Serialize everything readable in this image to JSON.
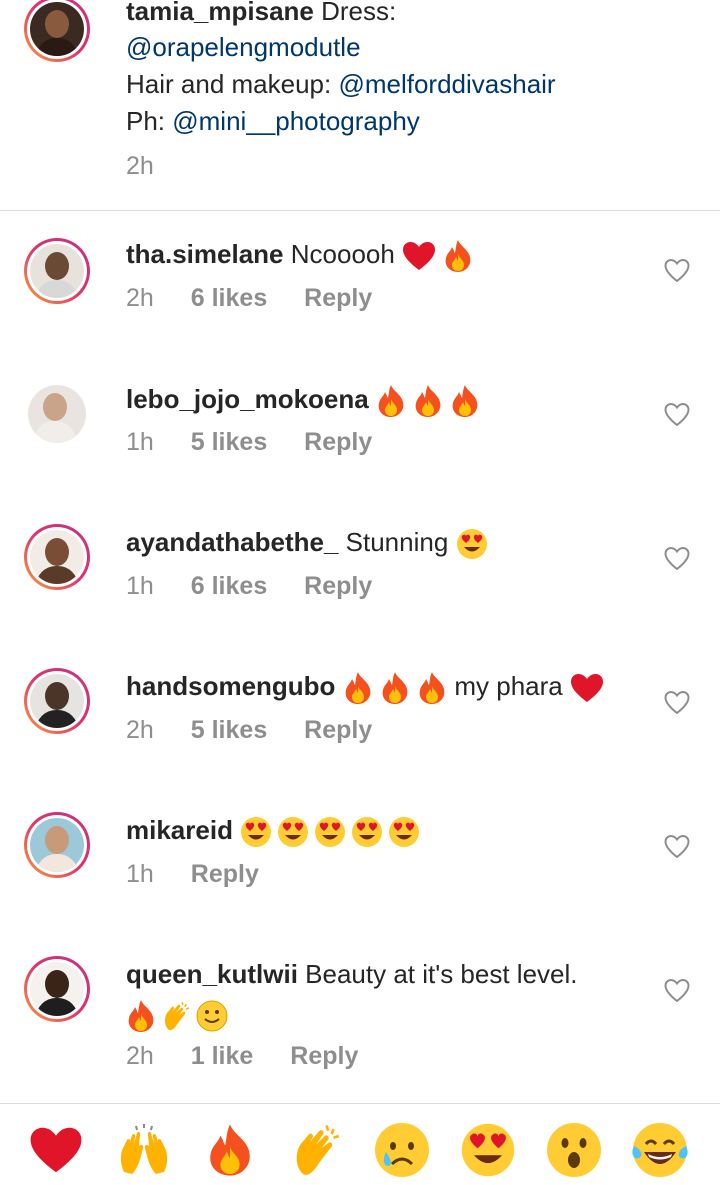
{
  "caption": {
    "username": "tamia_mpisane",
    "line1_text": "Dress:",
    "line2_link": "@orapelengmodutle",
    "line3_text": "Hair and makeup: ",
    "line3_link": "@melforddivashair",
    "line4_text": "Ph: ",
    "line4_link": "@mini__photography",
    "time": "2h"
  },
  "comments": [
    {
      "username": "tha.simelane",
      "text": "Ncooooh",
      "emojis": [
        "heart",
        "fire"
      ],
      "time": "2h",
      "likes": "6 likes",
      "reply": "Reply"
    },
    {
      "username": "lebo_jojo_mokoena",
      "text": "",
      "emojis": [
        "fire",
        "fire",
        "fire"
      ],
      "time": "1h",
      "likes": "5 likes",
      "reply": "Reply"
    },
    {
      "username": "ayandathabethe_",
      "text": "Stunning",
      "emojis": [
        "heart-eyes"
      ],
      "time": "1h",
      "likes": "6 likes",
      "reply": "Reply"
    },
    {
      "username": "handsomengubo",
      "text": "my phara",
      "emojis": [
        "fire",
        "fire",
        "fire",
        "heart"
      ],
      "time": "2h",
      "likes": "5 likes",
      "reply": "Reply"
    },
    {
      "username": "mikareid",
      "text": "",
      "emojis": [
        "heart-eyes",
        "heart-eyes",
        "heart-eyes",
        "heart-eyes",
        "heart-eyes"
      ],
      "time": "1h",
      "likes": "",
      "reply": "Reply"
    },
    {
      "username": "queen_kutlwii",
      "text": "Beauty at it's best level.",
      "emojis": [
        "fire",
        "clap",
        "smile"
      ],
      "time": "2h",
      "likes": "1 like",
      "reply": "Reply"
    }
  ],
  "quick_reactions": [
    "heart",
    "raised-hands",
    "fire",
    "clap",
    "sad",
    "heart-eyes",
    "surprised",
    "tears-of-joy"
  ],
  "colors": {
    "link": "#00376b",
    "meta": "#8e8e8e",
    "divider": "#dbdbdb",
    "ring_start": "#f9a13a",
    "ring_end": "#c13584"
  }
}
